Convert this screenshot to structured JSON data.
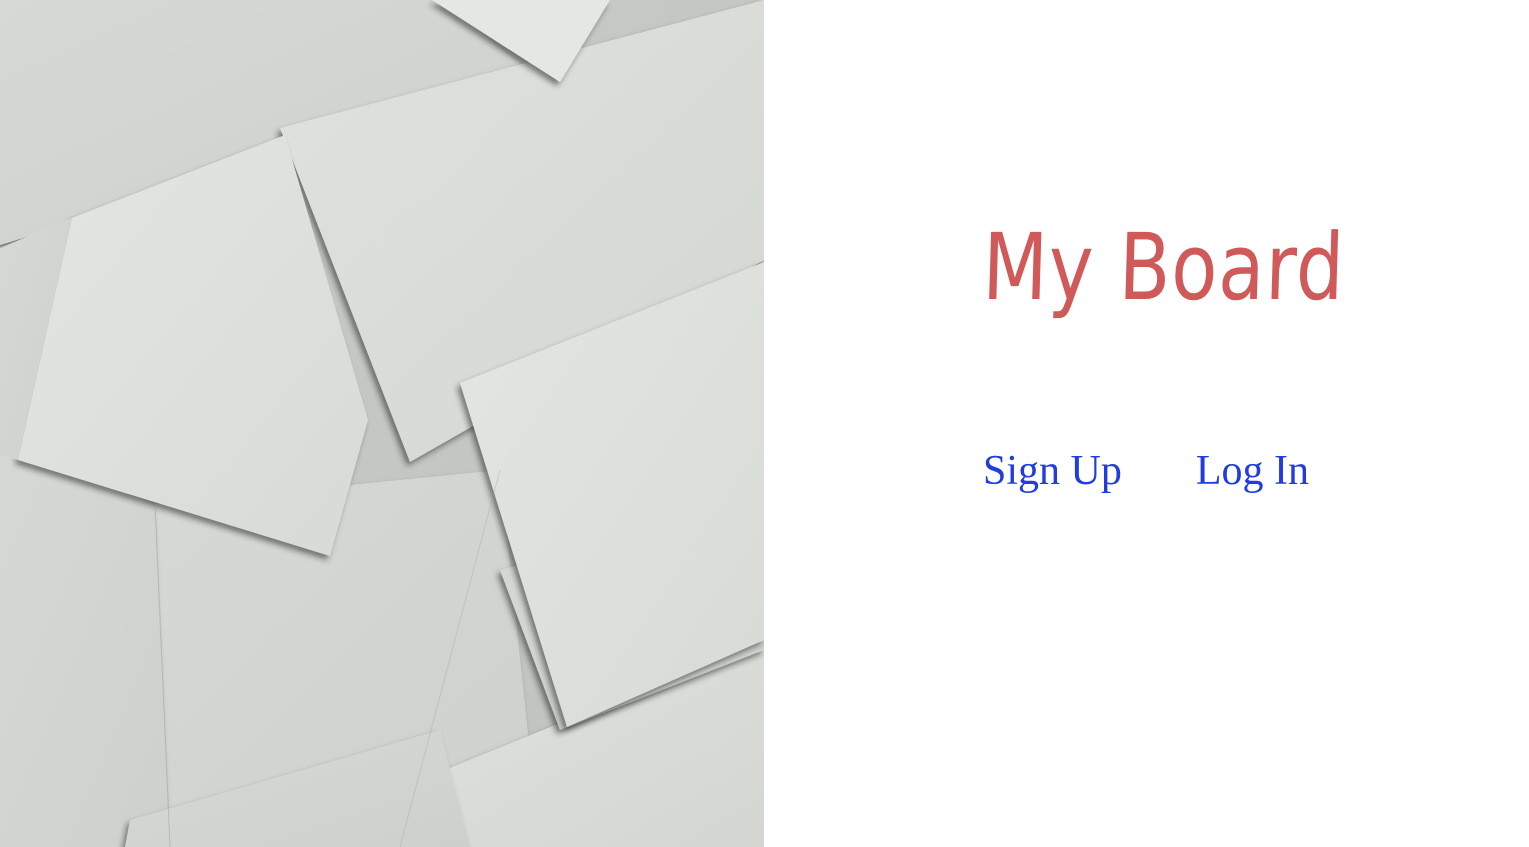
{
  "hero": {
    "image_name": "scattered-paper-cards-image",
    "paper_color": "#d9dcd7",
    "shadow_color": "#2b3029"
  },
  "brand": {
    "title": "My Board",
    "title_color": "#d05a5a"
  },
  "auth": {
    "sign_up_label": "Sign Up",
    "log_in_label": "Log In",
    "link_color": "#1f3de0"
  }
}
